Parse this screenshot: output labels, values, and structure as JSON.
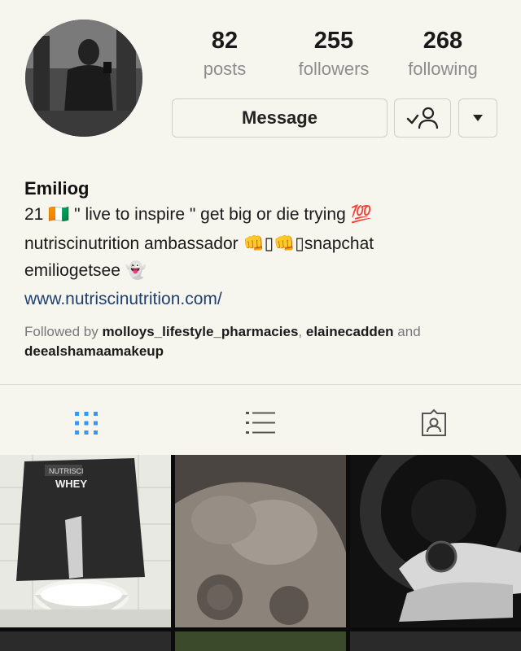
{
  "profile": {
    "username": "Emiliog",
    "avatar_icon": "profile-photo"
  },
  "stats": {
    "posts": {
      "value": "82",
      "label": "posts"
    },
    "followers": {
      "value": "255",
      "label": "followers"
    },
    "following": {
      "value": "268",
      "label": "following"
    }
  },
  "actions": {
    "message_label": "Message",
    "follow_icon": "person-check-icon",
    "more_icon": "caret-down-icon"
  },
  "bio": {
    "line1": "21 🇨🇮 \" live to inspire \" get big or die trying 💯",
    "line2": "nutriscinutrition ambassador 👊▯👊▯snapchat",
    "line3": "emiliogetsee 👻",
    "website": "www.nutriscinutrition.com/"
  },
  "followed_by": {
    "prefix": "Followed by ",
    "user1": "molloys_lifestyle_pharmacies",
    "separator": ", ",
    "user2": "elainecadden",
    "conjunction": " and",
    "user3": "deealshamaamakeup"
  },
  "tabs": [
    {
      "icon": "grid-icon",
      "active": true
    },
    {
      "icon": "list-icon",
      "active": false
    },
    {
      "icon": "tagged-icon",
      "active": false
    }
  ],
  "grid_images": [
    {
      "subject": "whey protein bag and bowl",
      "label": "WHEY",
      "brand": "NUTRISCI"
    },
    {
      "subject": "shoulder close-up"
    },
    {
      "subject": "steering wheel and wrist watch"
    }
  ],
  "colors": {
    "background": "#f7f6ee",
    "active_tab": "#3897f0",
    "link": "#1f3f70",
    "muted_text": "#8d8d8d"
  }
}
